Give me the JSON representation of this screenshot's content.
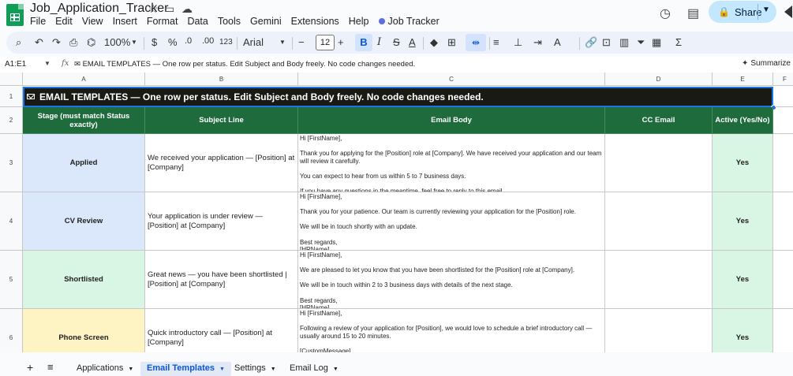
{
  "app": {
    "doc_title": "Job_Application_Tracker",
    "menus": [
      "File",
      "Edit",
      "View",
      "Insert",
      "Format",
      "Data",
      "Tools",
      "Gemini",
      "Extensions",
      "Help"
    ],
    "extension_menu": "Job Tracker",
    "share_label": "Share"
  },
  "toolbar": {
    "zoom": "100%",
    "currency": "$",
    "percent": "%",
    "decimal_decrease": ".0",
    "decimal_increase": ".00",
    "number_format": "123",
    "font": "Arial",
    "font_size": "12",
    "minus": "−",
    "plus": "+",
    "bold": "B",
    "italic": "I",
    "sigma": "Σ"
  },
  "formula_bar": {
    "name_box": "A1:E1",
    "fx": "fx",
    "formula": "✉ EMAIL TEMPLATES — One row per status. Edit Subject and Body freely. No code changes needed.",
    "summarize": "Summarize"
  },
  "columns": [
    "A",
    "B",
    "C",
    "D",
    "E",
    "F"
  ],
  "rows": [
    "1",
    "2",
    "3",
    "4",
    "5",
    "6"
  ],
  "sheet": {
    "banner": "EMAIL TEMPLATES — One row per status. Edit Subject and Body freely. No code changes needed.",
    "headers": [
      "Stage (must match Status exactly)",
      "Subject Line",
      "Email Body",
      "CC Email",
      "Active (Yes/No)"
    ],
    "records": [
      {
        "stage": "Applied",
        "subject": "We received your application — [Position] at [Company]",
        "body": "Hi [FirstName],\n\nThank you for applying for the [Position] role at [Company]. We have received your application and our team will review it carefully.\n\nYou can expect to hear from us within 5 to 7 business days.\n\nIf you have any questions in the meantime, feel free to reply to this email.",
        "cc": "",
        "active": "Yes"
      },
      {
        "stage": "CV Review",
        "subject": "Your application is under review — [Position] at [Company]",
        "body": "Hi [FirstName],\n\nThank you for your patience. Our team is currently reviewing your application for the [Position] role.\n\nWe will be in touch shortly with an update.\n\nBest regards,\n[HRName]",
        "cc": "",
        "active": "Yes"
      },
      {
        "stage": "Shortlisted",
        "subject": "Great news — you have been shortlisted | [Position] at [Company]",
        "body": "Hi [FirstName],\n\nWe are pleased to let you know that you have been shortlisted for the [Position] role at [Company].\n\nWe will be in touch within 2 to 3 business days with details of the next stage.\n\nBest regards,\n[HRName]",
        "cc": "",
        "active": "Yes"
      },
      {
        "stage": "Phone Screen",
        "subject": "Quick introductory call — [Position] at [Company]",
        "body": "Hi [FirstName],\n\nFollowing a review of your application for [Position], we would love to schedule a brief introductory call — usually around 15 to 20 minutes.\n\n[CustomMessage]",
        "cc": "",
        "active": "Yes"
      }
    ]
  },
  "tabs": [
    "Applications",
    "Email Templates",
    "Settings",
    "Email Log"
  ],
  "colors": {
    "banner_bg": "#1a1a14",
    "header_bg": "#1e6b3c",
    "applied": "#dbe8fb",
    "cv_review": "#dbe8fb",
    "shortlisted": "#d9f5e3",
    "phone_screen": "#fdf3c3",
    "active_bg": "#d9f5e3",
    "accent": "#0b57d0"
  },
  "icons": [
    "sheets-logo-icon",
    "star-icon",
    "move-to-folder-icon",
    "cloud-status-icon",
    "history-icon",
    "comments-icon",
    "lock-icon",
    "search-icon",
    "undo-icon",
    "redo-icon",
    "print-icon",
    "paint-format-icon",
    "fill-color-icon",
    "borders-icon",
    "merge-cells-icon",
    "link-icon",
    "insert-comment-icon",
    "insert-chart-icon",
    "filter-icon",
    "add-sheet-icon",
    "sheet-list-icon",
    "sparkle-icon"
  ]
}
